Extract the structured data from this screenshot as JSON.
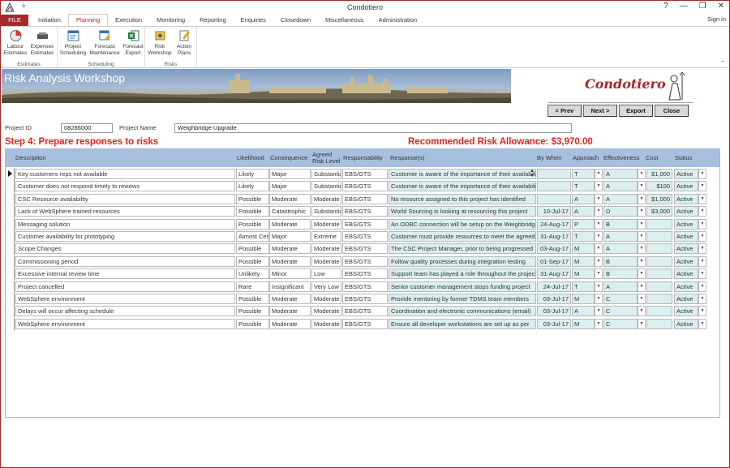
{
  "window": {
    "title": "Condotiero",
    "controls": [
      "?",
      "—",
      "❒",
      "✕"
    ],
    "sign_in": "Sign in"
  },
  "tabs": [
    {
      "label": "FILE"
    },
    {
      "label": "Initiation"
    },
    {
      "label": "Planning"
    },
    {
      "label": "Execution"
    },
    {
      "label": "Monitoring"
    },
    {
      "label": "Reporting"
    },
    {
      "label": "Enquiries"
    },
    {
      "label": "Closedown"
    },
    {
      "label": "Miscellaneous"
    },
    {
      "label": "Administration"
    }
  ],
  "ribbon": {
    "groups": [
      {
        "label": "Estimates",
        "buttons": [
          {
            "label": "Labour Estimates",
            "icon": "labour-estimates-icon"
          },
          {
            "label": "Expenses Estimates",
            "icon": "expenses-estimates-icon"
          }
        ]
      },
      {
        "label": "Scheduling",
        "buttons": [
          {
            "label": "Project Scheduling",
            "icon": "project-scheduling-icon"
          },
          {
            "label": "Forecast Maintenance",
            "icon": "forecast-maintenance-icon"
          },
          {
            "label": "Forecast Export",
            "icon": "forecast-export-icon"
          }
        ]
      },
      {
        "label": "Risks",
        "buttons": [
          {
            "label": "Risk Workshop",
            "icon": "risk-workshop-icon"
          },
          {
            "label": "Action Plans",
            "icon": "action-plans-icon"
          }
        ]
      }
    ]
  },
  "banner": {
    "title": "Risk Analysis Workshop",
    "logo_text": "Condotiero"
  },
  "nav_buttons": {
    "prev": "< Prev",
    "next": "Next >",
    "export": "Export",
    "close": "Close"
  },
  "project": {
    "id_label": "Project ID",
    "id_value": "08286000",
    "name_label": "Project Name",
    "name_value": "Weighbridge Upgrade"
  },
  "step_title": "Step 4: Prepare responses to risks",
  "allowance": "Recommended Risk Allowance: $3,970.00",
  "columns": {
    "description": "Description",
    "likelihood": "Likelihood",
    "consequence": "Consequence",
    "agreed": "Agreed Risk Level",
    "responsibility": "Responsability",
    "responses": "Response(s)",
    "bywhen": "By When",
    "approach": "Approach",
    "effectiveness": "Effectiveness",
    "cost": "Cost",
    "status": "Status"
  },
  "rows": [
    {
      "description": "Key customers reps not available",
      "likelihood": "Likely",
      "consequence": "Major",
      "agreed": "Substantial",
      "responsibility": "EBS/GTS",
      "response": "Customer is aware of the importance of their availability",
      "bywhen": "",
      "approach": "T",
      "effectiveness": "A",
      "cost": "$1,000",
      "status": "Active"
    },
    {
      "description": "Customer does not respond timely to reviews",
      "likelihood": "Likely",
      "consequence": "Major",
      "agreed": "Substantial",
      "responsibility": "EBS/GTS",
      "response": "Customer is aware of the importance of their availability",
      "bywhen": "",
      "approach": "T",
      "effectiveness": "A",
      "cost": "$100",
      "status": "Active"
    },
    {
      "description": "CSC Resource availability",
      "likelihood": "Possible",
      "consequence": "Moderate",
      "agreed": "Moderate",
      "responsibility": "EBS/GTS",
      "response": "No resource assigned to this project has identified",
      "bywhen": "",
      "approach": "A",
      "effectiveness": "A",
      "cost": "$1,000",
      "status": "Active"
    },
    {
      "description": "Lack of WebSphere trained resources",
      "likelihood": "Possible",
      "consequence": "Catastrophic",
      "agreed": "Substantial",
      "responsibility": "EBS/GTS",
      "response": "World Sourcing is looking at resourcing this project",
      "bywhen": "10-Jul-17",
      "approach": "A",
      "effectiveness": "D",
      "cost": "$3,000",
      "status": "Active"
    },
    {
      "description": "Messaging solution",
      "likelihood": "Possible",
      "consequence": "Moderate",
      "agreed": "Moderate",
      "responsibility": "EBS/GTS",
      "response": "An ODBC connection will be setup on the Weighbridge",
      "bywhen": "24-Aug-17",
      "approach": "P",
      "effectiveness": "B",
      "cost": "",
      "status": "Active"
    },
    {
      "description": "Customer availability for prototyping",
      "likelihood": "Almost Certain",
      "consequence": "Major",
      "agreed": "Extreme",
      "responsibility": "EBS/GTS",
      "response": "Customer must provide resources to meet the agreed",
      "bywhen": "31-Aug-17",
      "approach": "T",
      "effectiveness": "A",
      "cost": "",
      "status": "Active"
    },
    {
      "description": "Scope Changes",
      "likelihood": "Possible",
      "consequence": "Moderate",
      "agreed": "Moderate",
      "responsibility": "EBS/GTS",
      "response": "The CSC Project Manager, prior to being progressed",
      "bywhen": "03-Aug-17",
      "approach": "M",
      "effectiveness": "A",
      "cost": "",
      "status": "Active"
    },
    {
      "description": "Commissioning period",
      "likelihood": "Possible",
      "consequence": "Moderate",
      "agreed": "Moderate",
      "responsibility": "EBS/GTS",
      "response": "Follow quality processes during integration testing",
      "bywhen": "01-Sep-17",
      "approach": "M",
      "effectiveness": "B",
      "cost": "",
      "status": "Active"
    },
    {
      "description": "Excessive internal review time",
      "likelihood": "Unlikely",
      "consequence": "Minor",
      "agreed": "Low",
      "responsibility": "EBS/GTS",
      "response": "Support team has played a role throughout the project",
      "bywhen": "31-Aug-17",
      "approach": "M",
      "effectiveness": "B",
      "cost": "",
      "status": "Active"
    },
    {
      "description": "Project cancelled",
      "likelihood": "Rare",
      "consequence": "Insignificant",
      "agreed": "Very Low",
      "responsibility": "EBS/GTS",
      "response": "Senior customer management stops funding project",
      "bywhen": "24-Jul-17",
      "approach": "T",
      "effectiveness": "A",
      "cost": "",
      "status": "Active"
    },
    {
      "description": "WebSphere environment",
      "likelihood": "Possible",
      "consequence": "Moderate",
      "agreed": "Moderate",
      "responsibility": "EBS/GTS",
      "response": "Provide mentoring by former TDMS team members",
      "bywhen": "03-Jul-17",
      "approach": "M",
      "effectiveness": "C",
      "cost": "",
      "status": "Active"
    },
    {
      "description": "Delays will occur affecting schedule",
      "likelihood": "Possible",
      "consequence": "Moderate",
      "agreed": "Moderate",
      "responsibility": "EBS/GTS",
      "response": "Coordination and electronic communications (email)",
      "bywhen": "03-Jul-17",
      "approach": "A",
      "effectiveness": "C",
      "cost": "",
      "status": "Active"
    },
    {
      "description": "WebSphere environment",
      "likelihood": "Possible",
      "consequence": "Moderate",
      "agreed": "Moderate",
      "responsibility": "EBS/GTS",
      "response": "Ensure all developer workstations are set up as per",
      "bywhen": "03-Jul-17",
      "approach": "M",
      "effectiveness": "C",
      "cost": "",
      "status": "Active"
    }
  ],
  "colors": {
    "accent_red": "#e0251d",
    "file_tab": "#a5282b",
    "grid_header": "#a8c0e0",
    "tint": "#dbeef0"
  }
}
